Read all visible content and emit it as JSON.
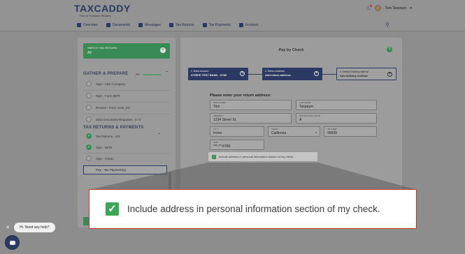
{
  "header": {
    "logo": "TAXCADDY",
    "logo_sub": "Part of Thomson Reuters",
    "user_name": "Tom Taxpayer",
    "nav": [
      "Overview",
      "Documents",
      "Messages",
      "Tax Returns",
      "Tax Payments",
      "Invoices"
    ]
  },
  "sidebar": {
    "switch_label": "SWITCH TAX RETURN",
    "switch_value": "All",
    "gather_title": "GATHER & PREPARE",
    "gather_pct": "0%",
    "gather_items": [
      "Sign - ABC Company",
      "Sign - Form 8879",
      "Review - Form 1040_ES",
      "2022 Document Requests - 0 / 2"
    ],
    "returns_title": "TAX RETURNS & PAYMENTS",
    "returns_items": [
      "Tax Returns - 4/4",
      "Sign - 8879",
      "Sign - F1041",
      "Pay - Tax Payment(s)"
    ]
  },
  "main": {
    "title": "Pay by Check",
    "steps": [
      {
        "label": "1. Bank Account",
        "value": "STRIPE TEST BANK - 6789"
      },
      {
        "label": "2. Return Address",
        "value": "Add return address"
      },
      {
        "label": "3. Default Delivery Interval",
        "value": "Add delivery method"
      }
    ],
    "form_heading": "Please enter your return address:",
    "fields": {
      "first_name": {
        "label": "FIRST NAME*",
        "value": "Tom"
      },
      "last_name": {
        "label": "LAST NAME*",
        "value": "Taxpayer"
      },
      "address": {
        "label": "ADDRESS*",
        "value": "1234 Street St."
      },
      "apt": {
        "label": "APT, BUILDING, SUITE",
        "value": "A"
      },
      "city": {
        "label": "CITY*",
        "value": "Irvine"
      },
      "state": {
        "label": "STATE*",
        "value": "California"
      },
      "zip": {
        "label": "ZIP CODE*",
        "value": "99999"
      },
      "ssn": {
        "label": "SSN*",
        "value": "***-**-6789"
      }
    },
    "checkbox_label": "Include address in personal information section of my check."
  },
  "callout_text": "Include address in personal information section of my check.",
  "chat": {
    "label": "Hi. Need any help?"
  },
  "colors": {
    "brand": "#2c3a63",
    "accent": "#3aa757",
    "highlight": "#c0392b"
  }
}
